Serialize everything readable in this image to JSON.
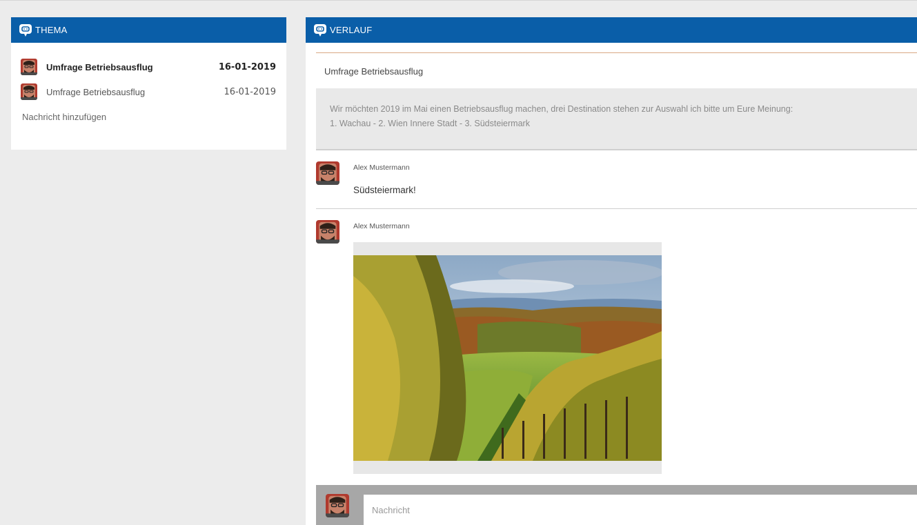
{
  "left_panel": {
    "header": "THEMA",
    "threads": [
      {
        "title": "Umfrage Betriebsausflug",
        "date": "16-01-2019"
      },
      {
        "title": "Umfrage Betriebsausflug",
        "date": "16-01-2019"
      }
    ],
    "add_message": "Nachricht hinzufügen"
  },
  "right_panel": {
    "header": "VERLAUF",
    "topic_title": "Umfrage Betriebsausflug",
    "topic_description_line1": "Wir möchten 2019 im Mai einen Betriebsausflug machen, drei Destination stehen zur Auswahl ich bitte um Eure Meinung:",
    "topic_description_line2": "1. Wachau  -  2. Wien Innere Stadt  -  3. Südsteiermark",
    "messages": [
      {
        "author": "Alex Mustermann",
        "text": "Südsteiermark!"
      },
      {
        "author": "Alex Mustermann",
        "image": "vineyard-landscape-photo"
      }
    ],
    "composer_placeholder": "Nachricht"
  },
  "colors": {
    "header_blue": "#0a5ea8",
    "background": "#ececec",
    "separator_orange": "#d9a884"
  },
  "icons": {
    "panel_header": "speech-bubble-icon"
  }
}
